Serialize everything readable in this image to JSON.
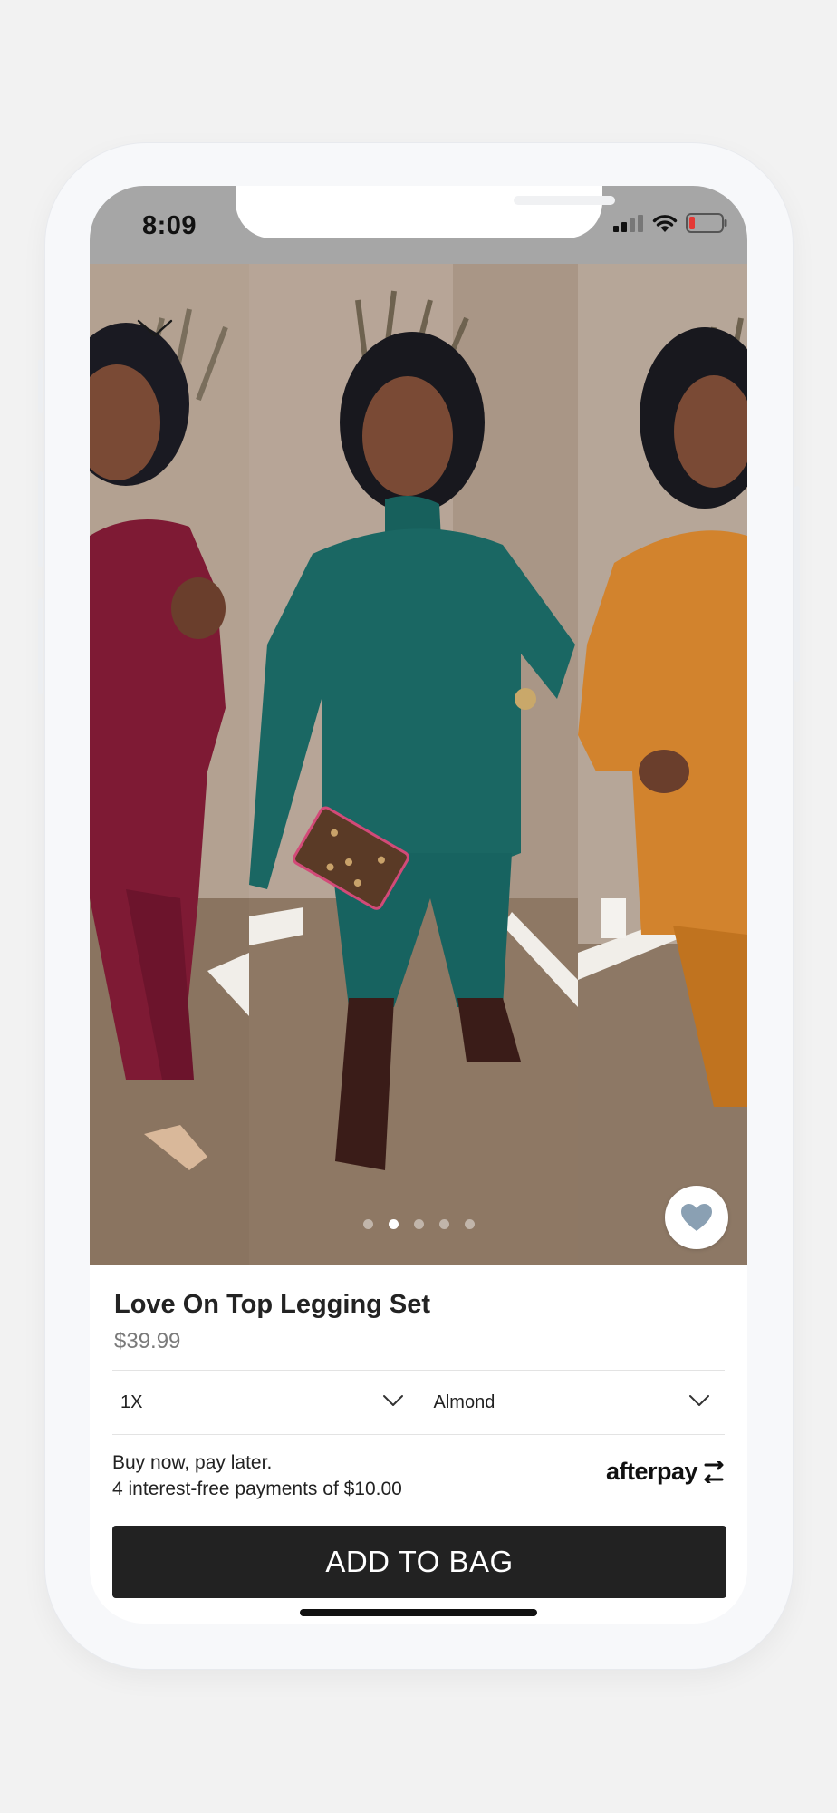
{
  "status_bar": {
    "time": "8:09",
    "icons": [
      "signal-icon",
      "wifi-icon",
      "battery-low-icon"
    ]
  },
  "gallery": {
    "image_count": 5,
    "active_index": 1,
    "colorways_shown": [
      "burgundy",
      "teal",
      "orange"
    ],
    "collapse_icon": "chevron-down-icon",
    "favorite_icon": "heart-icon"
  },
  "product": {
    "name": "Love On Top Legging Set",
    "price": "$39.99"
  },
  "selectors": {
    "size": "1X",
    "color": "Almond"
  },
  "afterpay": {
    "line1": "Buy now, pay later.",
    "line2": "4 interest-free payments of $10.00",
    "logo_text": "afterpay"
  },
  "cta": {
    "label": "ADD TO BAG"
  },
  "colors": {
    "status_bar": "#a6a6a6",
    "button": "#222222",
    "heart": "#8aa0b3",
    "battery_low": "#e53935"
  }
}
